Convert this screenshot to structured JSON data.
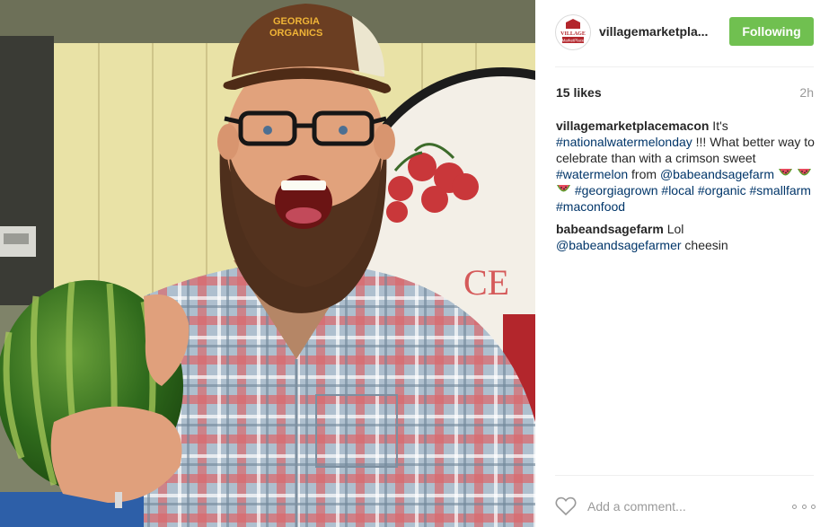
{
  "post": {
    "username": "villagemarketpla...",
    "follow_label": "Following",
    "likes": "15 likes",
    "time": "2h",
    "hat_text_line1": "GEORGIA",
    "hat_text_line2": "ORGANICS",
    "sign_text": "CE",
    "avatar_text_line1": "VILLAGE",
    "avatar_text_line2": "MarketPlace"
  },
  "caption": {
    "user": "villagemarketplacemacon",
    "text1": " It's ",
    "tag1": "#nationalwatermelonday",
    "text2": " !!! What better way to celebrate than with a crimson sweet ",
    "tag2": "#watermelon",
    "text3": " from ",
    "mention1": "@babeandsagefarm",
    "tag3": "#georgiagrown",
    "tag4": "#local",
    "tag5": "#organic",
    "tag6": "#smallfarm",
    "tag7": "#maconfood"
  },
  "reply": {
    "user": "babeandsagefarm",
    "text1": " Lol ",
    "mention": "@babeandsagefarmer",
    "text2": " cheesin"
  },
  "comment_box": {
    "placeholder": "Add a comment..."
  },
  "icons": {
    "like": "heart-icon",
    "more": "more-options-icon",
    "emoji": "watermelon-emoji"
  },
  "colors": {
    "follow_green": "#70c050",
    "tag_blue": "#003569",
    "muted_gray": "#999999"
  }
}
